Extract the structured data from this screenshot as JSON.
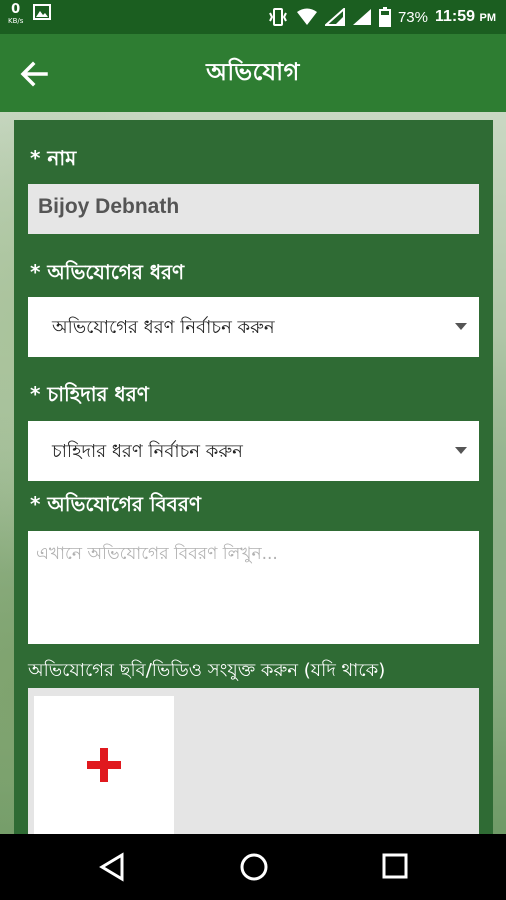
{
  "status_bar": {
    "net_speed_value": "0",
    "net_speed_unit": "KB/s",
    "battery_percent": "73%",
    "time": "11:59",
    "time_suffix": "PM"
  },
  "app_bar": {
    "title": "অভিযোগ"
  },
  "form": {
    "name_label": "* নাম",
    "name_value": "Bijoy Debnath",
    "complaint_type_label": "* অভিযোগের ধরণ",
    "complaint_type_selected": "অভিযোগের ধরণ নির্বাচন করুন",
    "demand_type_label": "* চাহিদার ধরণ",
    "demand_type_selected": "চাহিদার ধরণ নির্বাচন করুন",
    "description_label": "* অভিযোগের বিবরণ",
    "description_placeholder": "এখানে অভিযোগের বিবরণ লিখুন...",
    "attachment_label": "অভিযোগের ছবি/ভিডিও সংযুক্ত করুন (যদি থাকে)"
  },
  "colors": {
    "status_bar": "#1b5e20",
    "app_bar": "#2e7d32",
    "card": "#2f6b34",
    "plus": "#e0191e"
  }
}
